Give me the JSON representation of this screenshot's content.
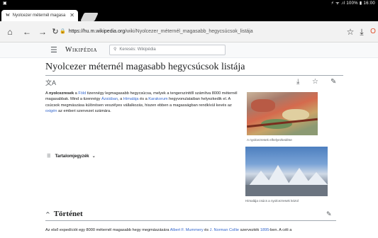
{
  "status_bar": {
    "right_text": "⚡ ᯤ .ıl 100% ▮ 16:00"
  },
  "browser": {
    "tab_title": "Nyolcezer méternél magasa",
    "url_host": "https://hu.m.wikipedia.org",
    "url_path": "/wiki/Nyolcezer_méternél_magasabb_hegycsúcsok_listája"
  },
  "wiki": {
    "wordmark": "Wikipédia",
    "search_placeholder": "Keresés: Wikipédia"
  },
  "article": {
    "title": "Nyolcezer méternél magasabb hegycsúcsok listája",
    "intro": {
      "t1": "A ",
      "b1": "nyolcezresek",
      "t2": " a ",
      "l1": "Föld",
      "t3": " tizennégy legmagasabb hegycsúcsa, melyek a tengerszinttől számítva 8000 méternél magasabbak. Mind a tizennégy ",
      "l2": "Ázsiában",
      "t4": ", a ",
      "l3": "Himalája",
      "t5": " és a ",
      "l4": "Karakorum",
      "t6": " hegyvonulataiban helyezkedik el. A csúcsok megmászása különösen veszélyes vállalkozás, hiszen ebben a magasságban rendkívül kevés az ",
      "l5": "oxigén",
      "t7": " az emberi szervezet számára."
    },
    "image1_caption": "A nyolcezresek elhelyezkedése",
    "image2_caption": "Himalája csúcs a nyolcezresek közül",
    "toc_label": "Tartalomjegyzék",
    "section_title": "Történet",
    "para2": {
      "t1": "Az első expedíciót egy 8000 méternél magasabb hegy megmászására ",
      "l1": "Albert F. Mummery",
      "t2": " és ",
      "l2": "J. Norman Collie",
      "t3": " szervezték ",
      "l3": "1895",
      "t4": "-ben. A céli a"
    }
  }
}
